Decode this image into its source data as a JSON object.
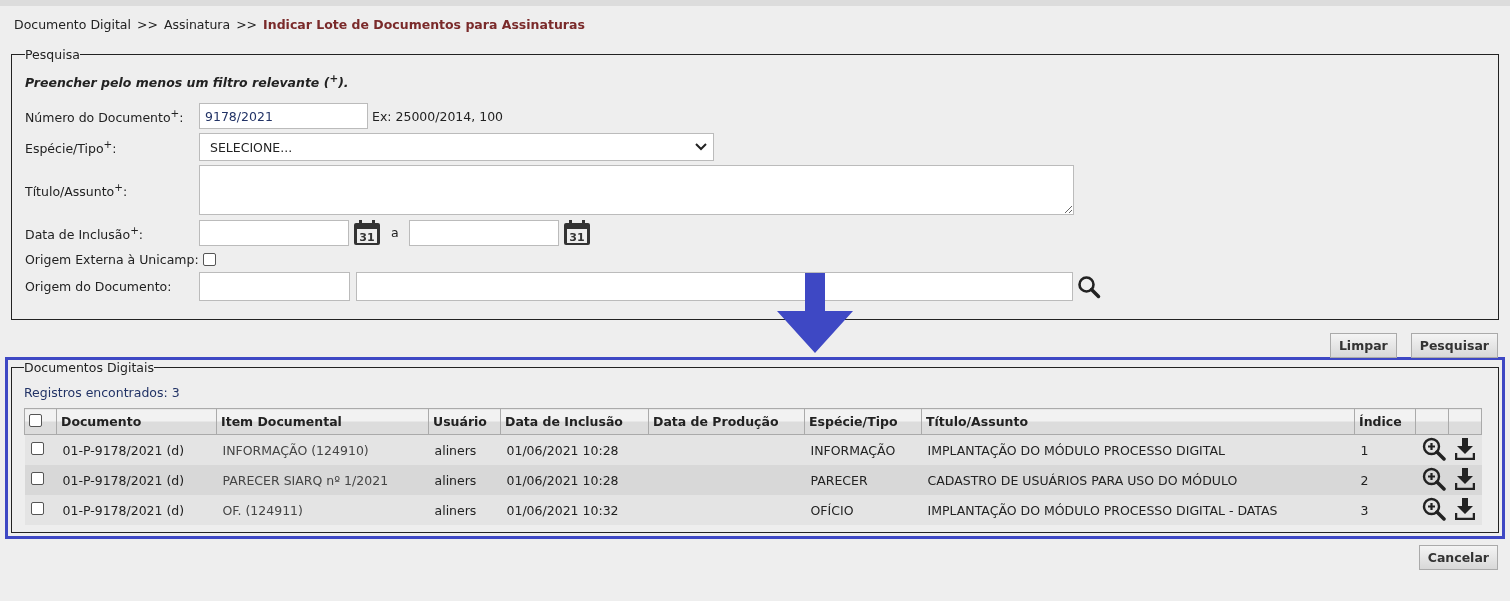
{
  "breadcrumb": {
    "items": [
      "Documento Digital",
      ">>",
      "Assinatura",
      ">>"
    ],
    "current": "Indicar Lote de Documentos para Assinaturas"
  },
  "search": {
    "legend": "Pesquisa",
    "hint": "Preencher pelo menos um filtro relevante ($^{+}$).",
    "document_number": {
      "label": "Número do Documento$^{+}$:",
      "value": "9178/2021",
      "example": "Ex: 25000/2014, 100"
    },
    "type": {
      "label": "Espécie/Tipo$^{+}$:",
      "value": "SELECIONE..."
    },
    "title": {
      "label": "Título/Assunto$^{+}$:"
    },
    "date": {
      "label": "Data de Inclusão$^{+}$:",
      "separator": "a",
      "calendar_icons": [
        "31",
        "31"
      ]
    },
    "external_origin": {
      "label": "Origem Externa à Unicamp:",
      "checked": false
    },
    "origin": {
      "label": "Origem do Documento:"
    }
  },
  "search_buttons": [
    "Limpar",
    "Pesquisar"
  ],
  "results": {
    "legend": "Documentos Digitais",
    "count": "Registros encontrados: 3",
    "select_all_checked": false,
    "columns": [
      "Documento",
      "Item Documental",
      "Usuário",
      "Data de Inclusão",
      "Data de Produção",
      "Espécie/Tipo",
      "Título/Assunto",
      "Índice"
    ],
    "rows": [
      {
        "checked": false,
        "cells": [
          "01-P-9178/2021 (d)",
          "INFORMAÇÃO (124910)",
          "aliners",
          "01/06/2021 10:28",
          "",
          "INFORMAÇÃO",
          "IMPLANTAÇÃO DO MÓDULO PROCESSO DIGITAL",
          "1"
        ]
      },
      {
        "checked": false,
        "cells": [
          "01-P-9178/2021 (d)",
          "PARECER SIARQ nº 1/2021",
          "aliners",
          "01/06/2021 10:28",
          "",
          "PARECER",
          "CADASTRO DE USUÁRIOS PARA USO DO MÓDULO",
          "2"
        ]
      },
      {
        "checked": false,
        "cells": [
          "01-P-9178/2021 (d)",
          "OF. (124911)",
          "aliners",
          "01/06/2021 10:32",
          "",
          "OFÍCIO",
          "IMPLANTAÇÃO DO MÓDULO PROCESSO DIGITAL - DATAS",
          "3"
        ]
      }
    ]
  },
  "footer_buttons": [
    "Cancelar"
  ]
}
